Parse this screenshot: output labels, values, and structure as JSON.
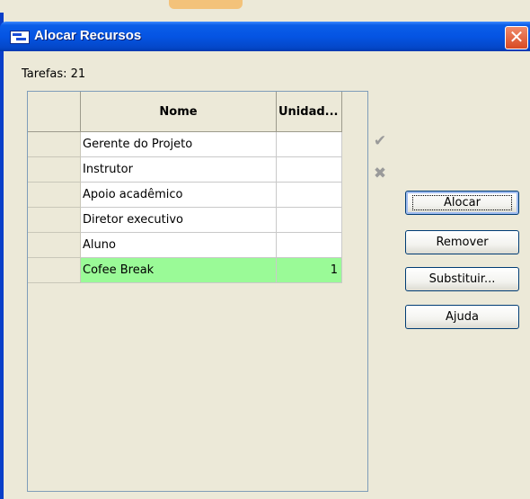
{
  "window": {
    "title": "Alocar Recursos",
    "close_glyph": "✕"
  },
  "tarefas_label": "Tarefas: 21",
  "table": {
    "columns": [
      "",
      "Nome",
      "Unidad..."
    ],
    "rows": [
      {
        "nome": "Gerente do Projeto",
        "unidades": ""
      },
      {
        "nome": "Instrutor",
        "unidades": ""
      },
      {
        "nome": "Apoio acadêmico",
        "unidades": ""
      },
      {
        "nome": "Diretor executivo",
        "unidades": ""
      },
      {
        "nome": "Aluno",
        "unidades": ""
      },
      {
        "nome": "Cofee Break",
        "unidades": "1"
      }
    ],
    "selected_row_index": 5,
    "selected_color": "#9afa97"
  },
  "side_icons": {
    "check": "check-icon",
    "cancel": "x-icon"
  },
  "buttons": {
    "alocar": "Alocar",
    "remover": "Remover",
    "substituir": "Substituir...",
    "ajuda": "Ajuda"
  },
  "colors": {
    "titlebar": "#0554e3",
    "window_bg": "#ece9d8",
    "close": "#d84a23"
  }
}
